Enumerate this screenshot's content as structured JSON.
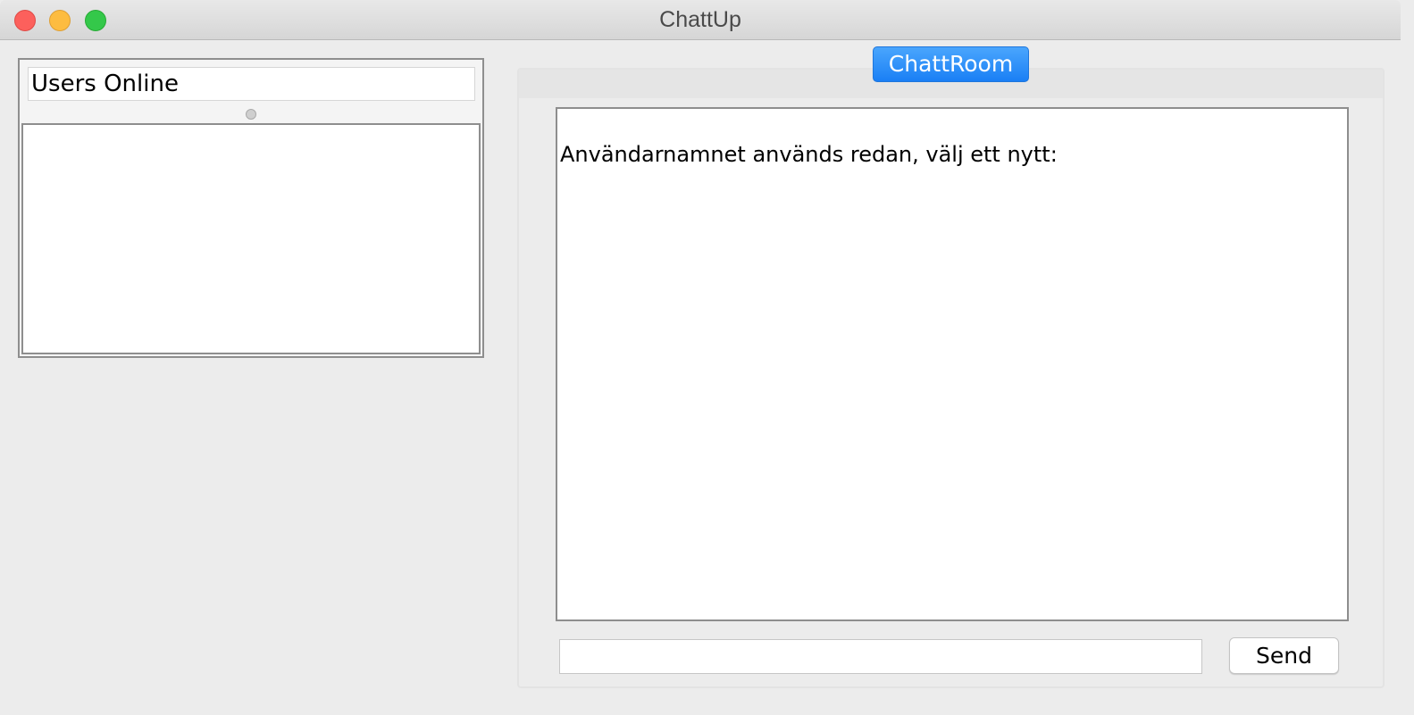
{
  "window": {
    "title": "ChattUp"
  },
  "users_panel": {
    "header": "Users Online",
    "users": []
  },
  "chat": {
    "tab_label": "ChattRoom",
    "messages": [
      "Användarnamnet används redan, välj ett nytt:"
    ],
    "input_value": "",
    "send_label": "Send"
  },
  "colors": {
    "tab_accent": "#1a7ff5",
    "close": "#fc605c",
    "minimize": "#fdbc40",
    "maximize": "#34c84a"
  }
}
